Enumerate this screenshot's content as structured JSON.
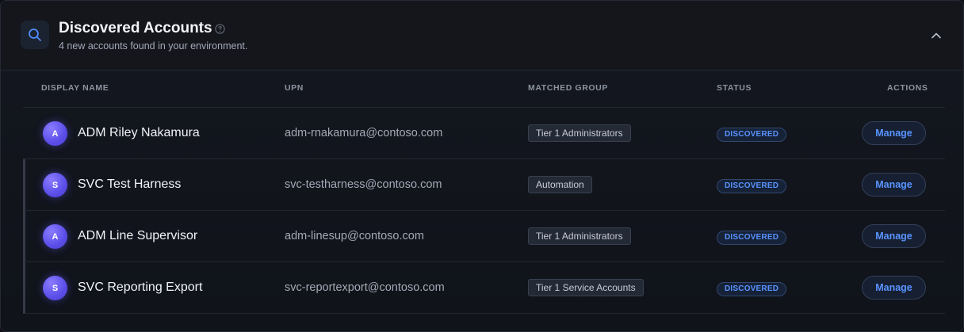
{
  "header": {
    "title": "Discovered Accounts",
    "subtitle": "4 new accounts found in your environment."
  },
  "columns": {
    "display_name": "DISPLAY NAME",
    "upn": "UPN",
    "matched_group": "MATCHED GROUP",
    "status": "STATUS",
    "actions": "ACTIONS"
  },
  "rows": [
    {
      "initial": "A",
      "name": "ADM Riley Nakamura",
      "upn": "adm-rnakamura@contoso.com",
      "group": "Tier 1 Administrators",
      "status": "DISCOVERED",
      "action": "Manage"
    },
    {
      "initial": "S",
      "name": "SVC Test Harness",
      "upn": "svc-testharness@contoso.com",
      "group": "Automation",
      "status": "DISCOVERED",
      "action": "Manage"
    },
    {
      "initial": "A",
      "name": "ADM Line Supervisor",
      "upn": "adm-linesup@contoso.com",
      "group": "Tier 1 Administrators",
      "status": "DISCOVERED",
      "action": "Manage"
    },
    {
      "initial": "S",
      "name": "SVC Reporting Export",
      "upn": "svc-reportexport@contoso.com",
      "group": "Tier 1 Service Accounts",
      "status": "DISCOVERED",
      "action": "Manage"
    }
  ],
  "icons": {
    "header": "search-icon",
    "help": "help-circle-icon",
    "collapse": "chevron-up-icon"
  },
  "colors": {
    "accent": "#5a93ff",
    "avatar": "#5b4ee8",
    "background": "#10131a"
  }
}
